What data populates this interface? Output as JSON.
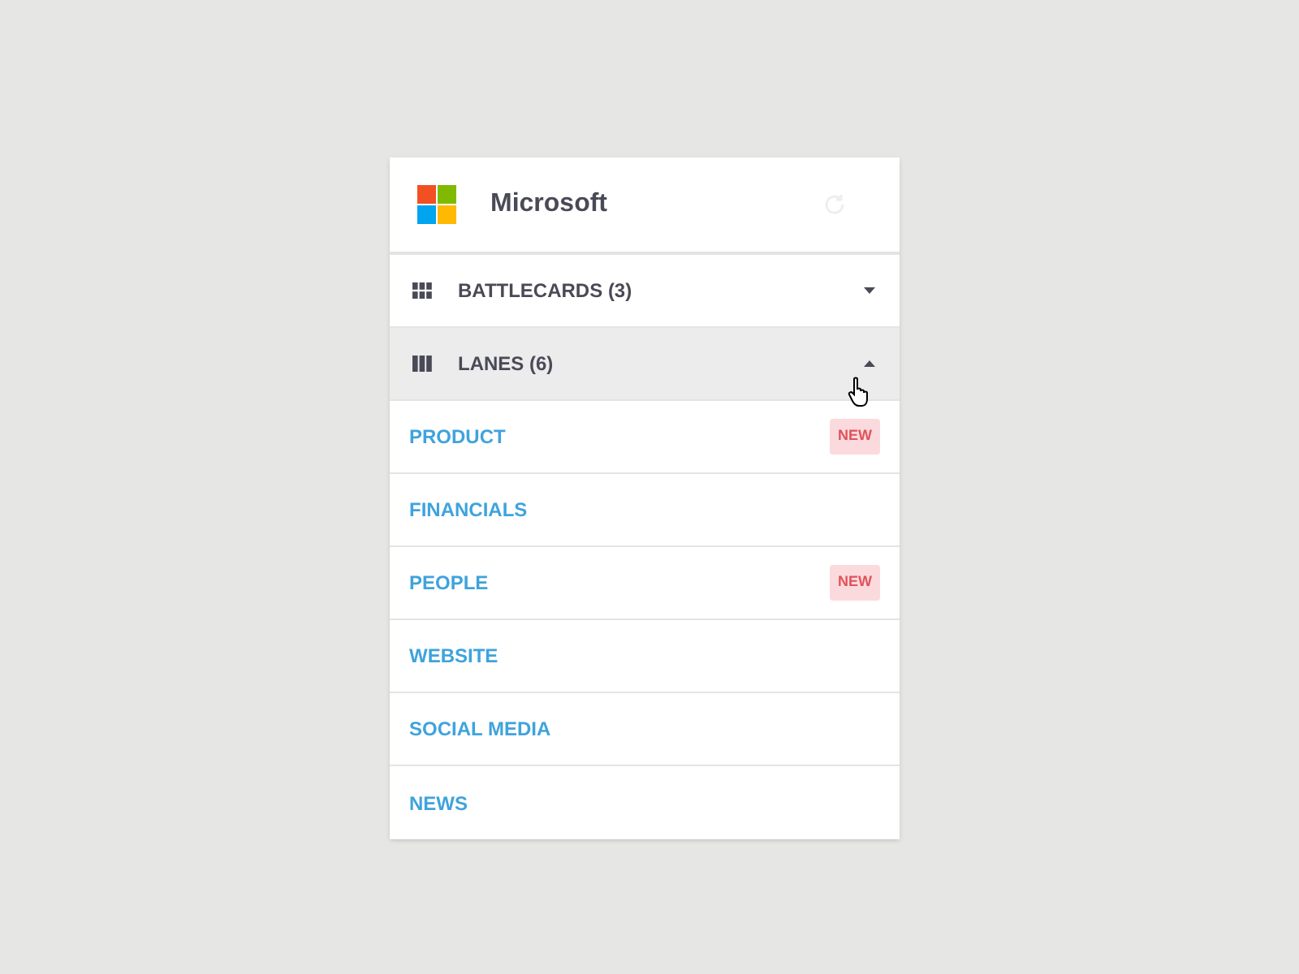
{
  "header": {
    "company": "Microsoft"
  },
  "sections": [
    {
      "kind": "grid",
      "label": "BATTLECARDS (3)",
      "expanded": false
    },
    {
      "kind": "columns",
      "label": "LANES (6)",
      "expanded": true,
      "items": [
        {
          "label": "PRODUCT",
          "badge": "NEW"
        },
        {
          "label": "FINANCIALS"
        },
        {
          "label": "PEOPLE",
          "badge": "NEW"
        },
        {
          "label": "WEBSITE"
        },
        {
          "label": "SOCIAL MEDIA"
        },
        {
          "label": "NEWS"
        }
      ]
    }
  ]
}
